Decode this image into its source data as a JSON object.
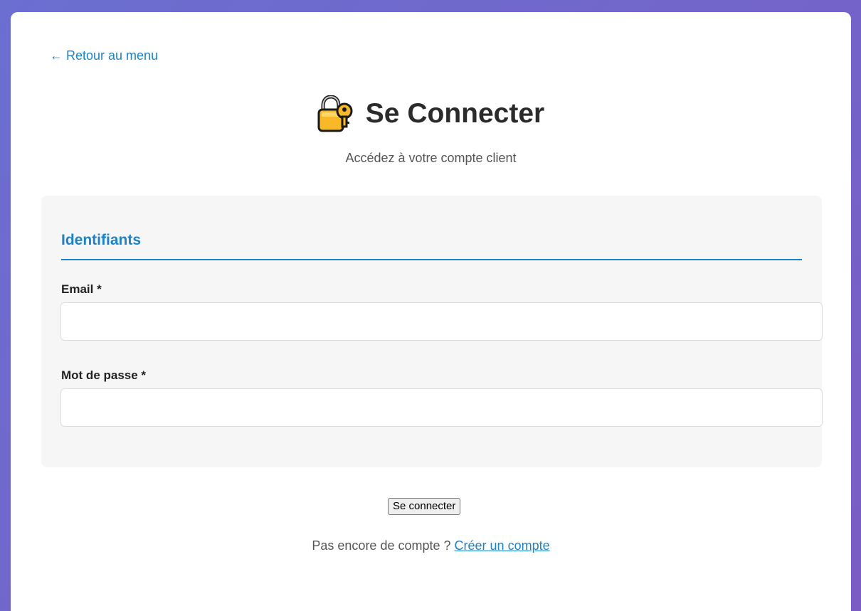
{
  "nav": {
    "back_label": "← Retour au menu"
  },
  "header": {
    "icon": "lock-key-icon",
    "title": "Se Connecter",
    "subtitle": "Accédez à votre compte client"
  },
  "form": {
    "section_title": "Identifiants",
    "email_label": "Email *",
    "email_value": "",
    "password_label": "Mot de passe *",
    "password_value": "",
    "submit_label": "Se connecter"
  },
  "footer": {
    "prompt": "Pas encore de compte ?",
    "signup_label": "Créer un compte"
  },
  "colors": {
    "background": "#6b6fd0",
    "accent": "#1e82c8",
    "panel": "#f6f6f6",
    "lock_body": "#f7b928"
  }
}
